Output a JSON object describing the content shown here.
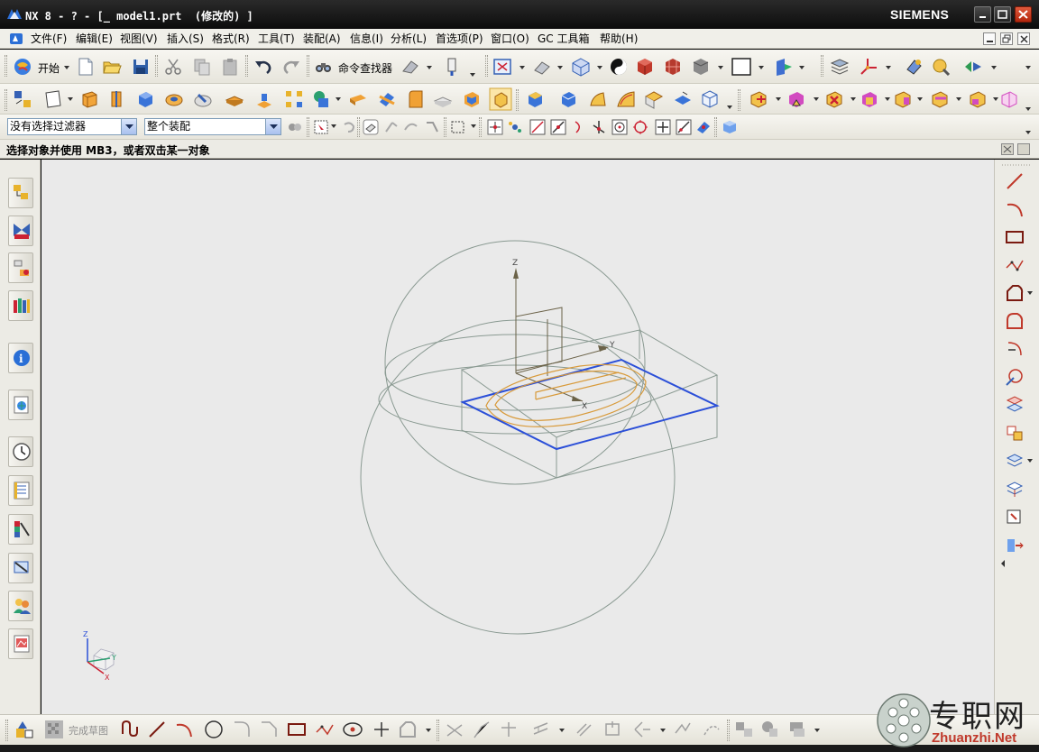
{
  "window": {
    "title": "NX 8 - ? - [_ model1.prt  (修改的) ]",
    "brand": "SIEMENS"
  },
  "menu": {
    "items": [
      "文件(F)",
      "编辑(E)",
      "视图(V)",
      "插入(S)",
      "格式(R)",
      "工具(T)",
      "装配(A)",
      "信息(I)",
      "分析(L)",
      "首选项(P)",
      "窗口(O)",
      "GC 工具箱",
      "帮助(H)"
    ]
  },
  "toolbar": {
    "start_label": "开始",
    "command_finder_label": "命令查找器"
  },
  "selection": {
    "filter_value": "没有选择过滤器",
    "scope_value": "整个装配"
  },
  "cue_line": "选择对象并使用 MB3，或者双击某一对象",
  "sketch": {
    "finish_sketch_label": "完成草图"
  },
  "viewport": {
    "axis_labels": {
      "z": "Z",
      "y": "Y",
      "x": "X"
    },
    "triad_labels": {
      "z": "Z",
      "y": "Y",
      "x": "X"
    },
    "colors": {
      "background": "#eaeaea",
      "sketch_plane": "#2b4fd8",
      "curve": "#d89a3a",
      "wireframe": "#8a9a92",
      "datum": "#6b6248"
    }
  },
  "watermark": {
    "text": "专职网",
    "url": "Zhuanzhi.Net"
  },
  "icons": {
    "resource_bar": [
      "assembly-navigator-icon",
      "constraint-navigator-icon",
      "part-navigator-icon",
      "reuse-library-icon",
      "hd3d-tools-icon",
      "web-browser-icon",
      "history-icon",
      "process-studio-icon",
      "system-materials-icon",
      "system-scenes-icon",
      "roles-icon",
      "palettes-icon"
    ],
    "sketch_toolbar": [
      "line-icon",
      "arc-icon",
      "rectangle-icon",
      "studio-spline-icon",
      "profile-icon",
      "fillet-icon",
      "trim-icon",
      "offset-icon",
      "mirror-icon",
      "pattern-icon",
      "extrude-icon",
      "revolve-icon",
      "project-icon",
      "intersect-icon",
      "derived-icon"
    ]
  }
}
